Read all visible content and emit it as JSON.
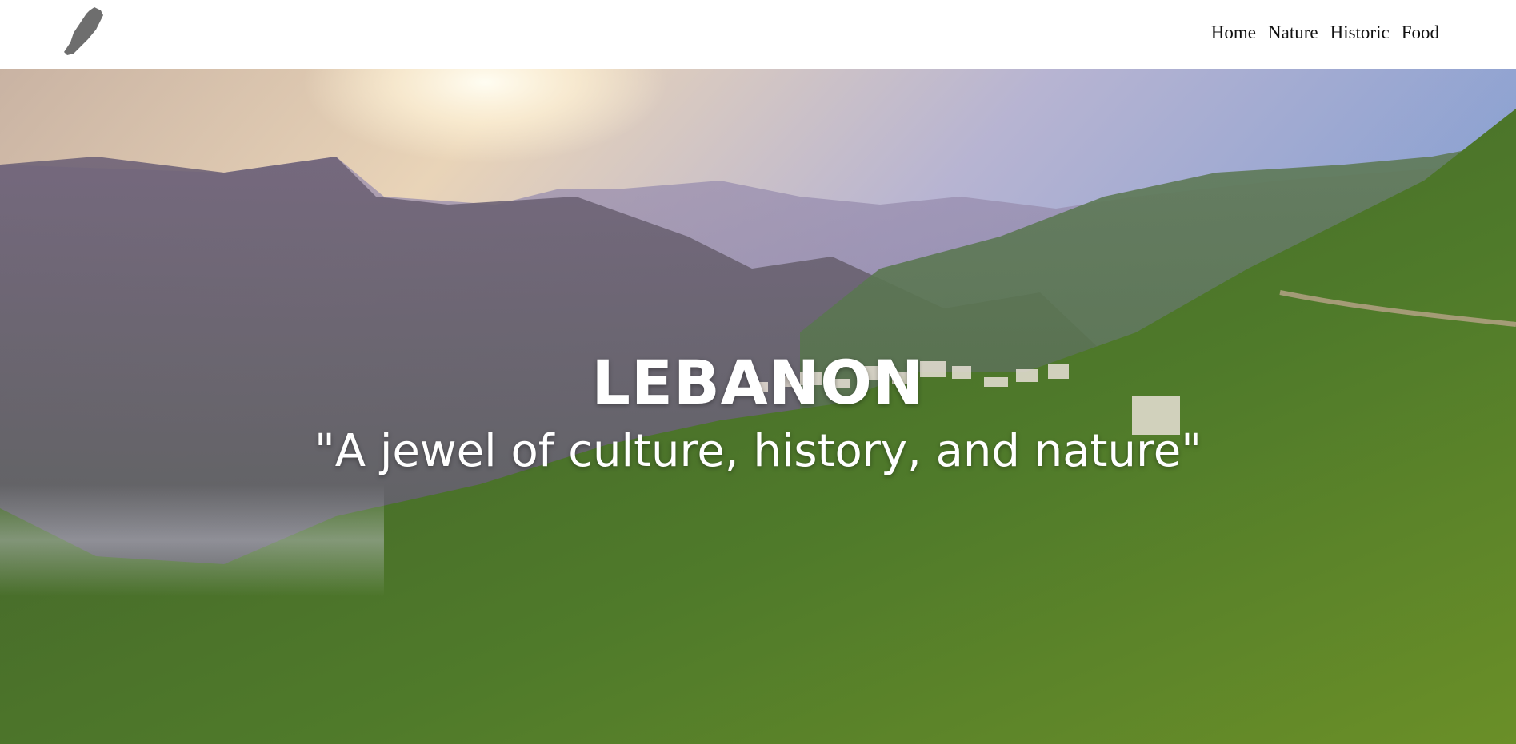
{
  "navbar": {
    "logo_icon": "lebanon-map-icon",
    "links": [
      {
        "label": "Home"
      },
      {
        "label": "Nature"
      },
      {
        "label": "Historic"
      },
      {
        "label": "Food"
      }
    ]
  },
  "hero": {
    "title": "LEBANON",
    "subtitle": "\"A jewel of culture, history, and nature\""
  },
  "colors": {
    "navbar_bg": "#ffffff",
    "nav_text": "#111111",
    "hero_text": "#ffffff",
    "logo_fill": "#6e6e6e"
  }
}
